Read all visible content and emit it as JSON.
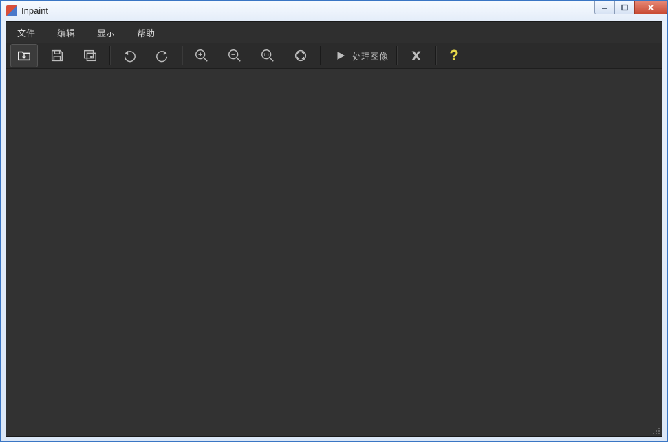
{
  "window": {
    "title": "Inpaint"
  },
  "menu": {
    "file": "文件",
    "edit": "编辑",
    "view": "显示",
    "help": "帮助"
  },
  "toolbar": {
    "open": "open-icon",
    "save": "save-icon",
    "gallery": "gallery-icon",
    "undo": "undo-icon",
    "redo": "redo-icon",
    "zoom_in": "zoom-in-icon",
    "zoom_out": "zoom-out-icon",
    "zoom_actual": "zoom-actual-icon",
    "zoom_fit": "zoom-fit-icon",
    "process_label": "处理图像",
    "cancel": "cancel-icon",
    "help_glyph": "?"
  },
  "colors": {
    "app_bg": "#2f2f2f",
    "toolbar_bg": "#2b2b2b",
    "icon": "#bdbdbd",
    "help_accent": "#e8d94a",
    "close_btn": "#c84a33"
  }
}
